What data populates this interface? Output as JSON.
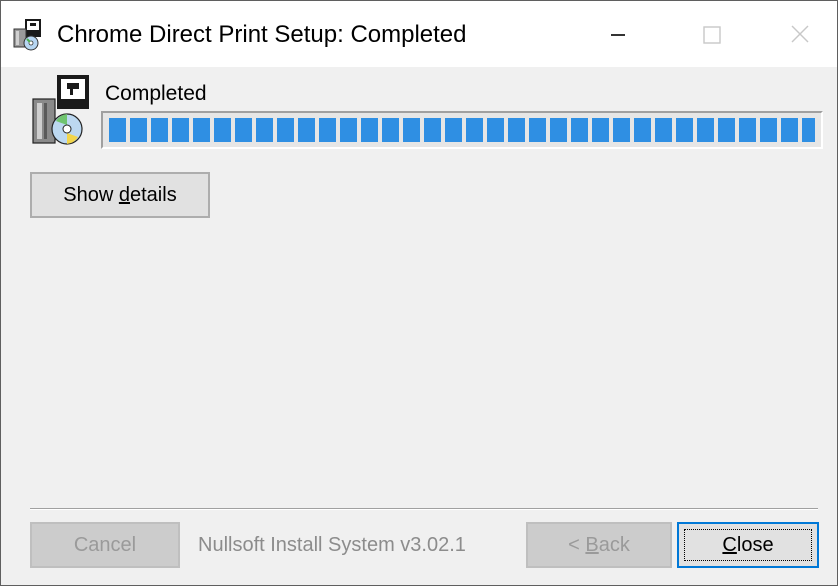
{
  "window": {
    "title": "Chrome Direct Print Setup: Completed",
    "controls": {
      "minimize_icon": "minimize-icon",
      "maximize_icon": "maximize-icon",
      "close_icon": "close-icon"
    }
  },
  "status": {
    "label": "Completed",
    "progress_percent": 100,
    "progress_color": "#2f8fe3"
  },
  "details_button": {
    "label_pre": "Show ",
    "label_mnemonic": "d",
    "label_post": "etails"
  },
  "footer": {
    "cancel_label": "Cancel",
    "branding": "Nullsoft Install System v3.02.1",
    "back_pre": "< ",
    "back_mnemonic": "B",
    "back_post": "ack",
    "close_mnemonic": "C",
    "close_post": "lose"
  },
  "colors": {
    "accent": "#0078d7",
    "background": "#f0f0f0",
    "disabled_text": "#9a9a9a"
  }
}
